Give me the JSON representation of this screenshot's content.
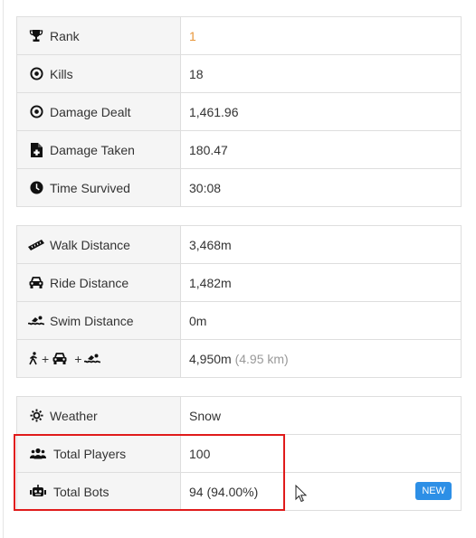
{
  "group1": [
    {
      "label": "Rank",
      "value": "1",
      "icon": "trophy-icon"
    },
    {
      "label": "Kills",
      "value": "18",
      "icon": "target-icon"
    },
    {
      "label": "Damage Dealt",
      "value": "1,461.96",
      "icon": "target-icon"
    },
    {
      "label": "Damage Taken",
      "value": "180.47",
      "icon": "file-medical-icon"
    },
    {
      "label": "Time Survived",
      "value": "30:08",
      "icon": "clock-icon"
    }
  ],
  "group2": [
    {
      "label": "Walk Distance",
      "value": "3,468m",
      "icon": "ruler-icon"
    },
    {
      "label": "Ride Distance",
      "value": "1,482m",
      "icon": "car-icon"
    },
    {
      "label": "Swim Distance",
      "value": "0m",
      "icon": "swimmer-icon"
    },
    {
      "plus1": "+",
      "plus2": "+",
      "value": "4,950m",
      "value_km": "(4.95 km)"
    }
  ],
  "group3": [
    {
      "label": "Weather",
      "value": "Snow",
      "icon": "sun-icon"
    },
    {
      "label": "Total Players",
      "value": "100",
      "icon": "users-icon"
    },
    {
      "label": "Total Bots",
      "value": "94 (94.00%)",
      "icon": "robot-icon",
      "badge": "NEW"
    }
  ],
  "colors": {
    "accent": "#e8963a",
    "highlight": "#e01b1b",
    "badge": "#2d8fe6"
  }
}
